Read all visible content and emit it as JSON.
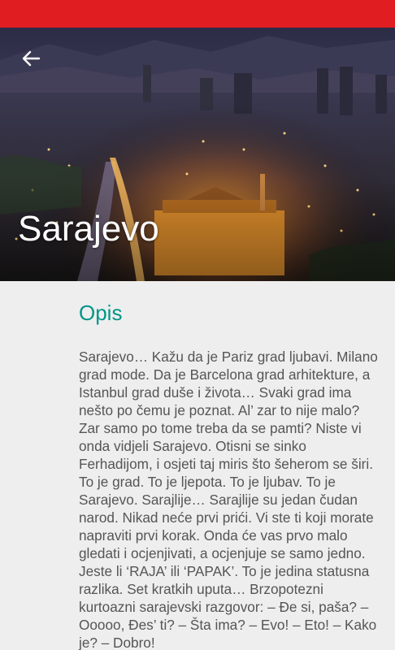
{
  "status_bar": {
    "color": "#e01e22"
  },
  "header": {
    "back_icon": "arrow-back-icon",
    "title": "Sarajevo"
  },
  "section": {
    "heading": "Opis",
    "heading_color": "#009688",
    "body": "Sarajevo… Kažu da je Pariz grad ljubavi. Milano grad mode. Da je Barcelona grad arhitekture, a Istanbul grad duše i života… Svaki grad ima nešto po čemu je poznat. Al’ zar to nije malo? Zar samo po tome treba da se pamti? Niste vi onda vidjeli Sarajevo. Otisni se sinko Ferhadijom, i osjeti taj miris što šeherom se širi. To je grad. To je ljepota. To je ljubav. To je Sarajevo. Sarajlije… Sarajlije su jedan čudan narod. Nikad neće prvi prići. Vi ste ti koji morate napraviti prvi korak. Onda će vas prvo malo gledati i ocjenjivati, a ocjenjuje se samo jedno. Jeste li ‘RAJA’ ili ‘PAPAK’. To je jedina statusna razlika. Set kratkih uputa… Brzopotezni kurtoazni sarajevski razgovor: – Đe si, paša? – Ooooo, Đes’ ti? – Šta ima? – Evo! – Eto! – Kako je? – Dobro!"
  }
}
